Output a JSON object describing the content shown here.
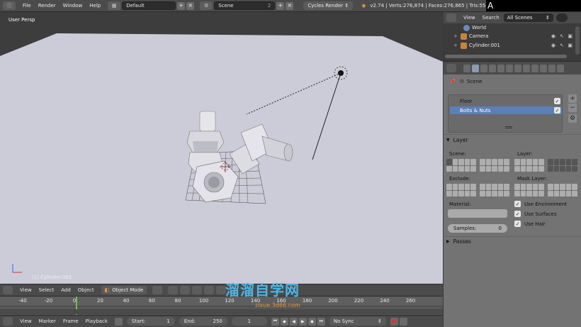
{
  "topbar": {
    "menus": [
      "File",
      "Render",
      "Window",
      "Help"
    ],
    "layout": "Default",
    "scene": "Scene",
    "scene_count": "2",
    "engine": "Cycles Render",
    "stats": "v2.74 | Verts:276,874 | Faces:276,865 | Tris:553",
    "overlay_char": "A"
  },
  "viewport": {
    "label": "User Persp",
    "object": "(1) Cylinder.002"
  },
  "viewport_header": {
    "menus": [
      "View",
      "Select",
      "Add",
      "Object"
    ],
    "mode": "Object Mode"
  },
  "timeline": {
    "ticks": [
      "-40",
      "-20",
      "0",
      "20",
      "40",
      "60",
      "80",
      "100",
      "120",
      "140",
      "160",
      "180",
      "200",
      "220",
      "240",
      "260"
    ],
    "current": 0
  },
  "timeline_header": {
    "menus": [
      "View",
      "Marker",
      "Frame",
      "Playback"
    ],
    "start_label": "Start:",
    "start_value": "1",
    "end_label": "End:",
    "end_value": "250",
    "current_value": "1",
    "sync": "No Sync"
  },
  "outliner": {
    "menus": [
      "View",
      "Search"
    ],
    "filter": "All Scenes",
    "rows": [
      "World",
      "Camera",
      "Cylinder.001"
    ]
  },
  "properties": {
    "scene_name": "Scene",
    "render_layers": [
      "Floor",
      "Bolts & Nuts"
    ],
    "layer_section": "Layer",
    "scene_label": "Scene:",
    "layer_label": "Layer:",
    "exclude_label": "Exclude:",
    "mask_label": "Mask Layer:",
    "material_label": "Material:",
    "samples_label": "Samples:",
    "samples_value": "0",
    "use_environment": "Use Environment",
    "use_surfaces": "Use Surfaces",
    "use_hair": "Use Hair",
    "passes_section": "Passes"
  },
  "watermark": {
    "main": "溜溜自学网",
    "sub": "zixue.3d66.com"
  }
}
